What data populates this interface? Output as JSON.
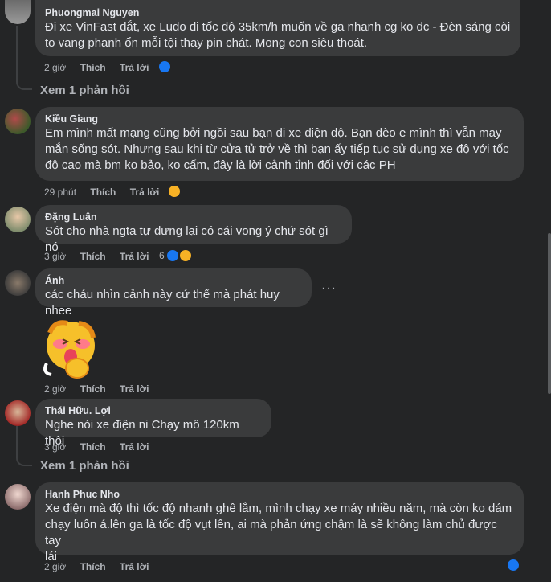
{
  "comments": [
    {
      "author": "Phuongmai Nguyen",
      "lines": [
        "Đi xe VinFast đắt, xe Ludo đi tốc độ 35km/h muốn về ga nhanh cg ko dc - Đèn sáng còi",
        "to vang phanh ổn mỗi tội thay pin chát. Mong con siêu thoát."
      ],
      "time": "2 giờ",
      "like_label": "Thích",
      "reply_label": "Trả lời",
      "view_replies": "Xem 1 phản hồi"
    },
    {
      "author": "Kiều Giang",
      "lines": [
        "Em mình mất mạng cũng bởi ngồi sau bạn đi xe điện độ. Bạn đèo e mình thì vẫn may",
        "mắn sống sót. Nhưng sau khi từ cửa tử trở về thì bạn ấy tiếp tục sử dụng xe độ với tốc",
        "độ cao mà bm ko bảo, ko cấm, đây là lời cảnh tỉnh đối với các PH"
      ],
      "time": "29 phút",
      "like_label": "Thích",
      "reply_label": "Trả lời"
    },
    {
      "author": "Đặng Luân",
      "lines": [
        "Sót cho nhà ngta tự dưng lại có cái vong ý chứ sót gì nó"
      ],
      "time": "3 giờ",
      "like_label": "Thích",
      "reply_label": "Trả lời",
      "reaction_count": "6"
    },
    {
      "author": "Ánh",
      "lines": [
        "các cháu nhìn cảnh này cứ thế mà phát huy nhee"
      ],
      "time": "2 giờ",
      "like_label": "Thích",
      "reply_label": "Trả lời",
      "more_label": "···"
    },
    {
      "author": "Thái Hữu. Lợi",
      "lines": [
        "Nghe nói xe điện ni Chạy mô 120km thôi"
      ],
      "time": "3 giờ",
      "like_label": "Thích",
      "reply_label": "Trả lời",
      "view_replies": "Xem 1 phản hồi"
    },
    {
      "author": "Hanh Phuc Nho",
      "lines": [
        "Xe điện mà độ thì tốc độ nhanh ghê lắm, mình chạy xe máy nhiều năm, mà còn ko dám",
        "chạy luôn á.lên ga là tốc độ vụt lên, ai mà phản ứng chậm là sẽ không làm chủ được tay",
        "lái"
      ],
      "time": "2 giờ",
      "like_label": "Thích",
      "reply_label": "Trả lời"
    }
  ],
  "colors": {
    "background": "#242526",
    "bubble": "#3a3b3c",
    "text": "#e4e6eb",
    "secondary": "#b0b3b8",
    "like_blue": "#1877f2",
    "sad_yellow": "#f7b125"
  }
}
